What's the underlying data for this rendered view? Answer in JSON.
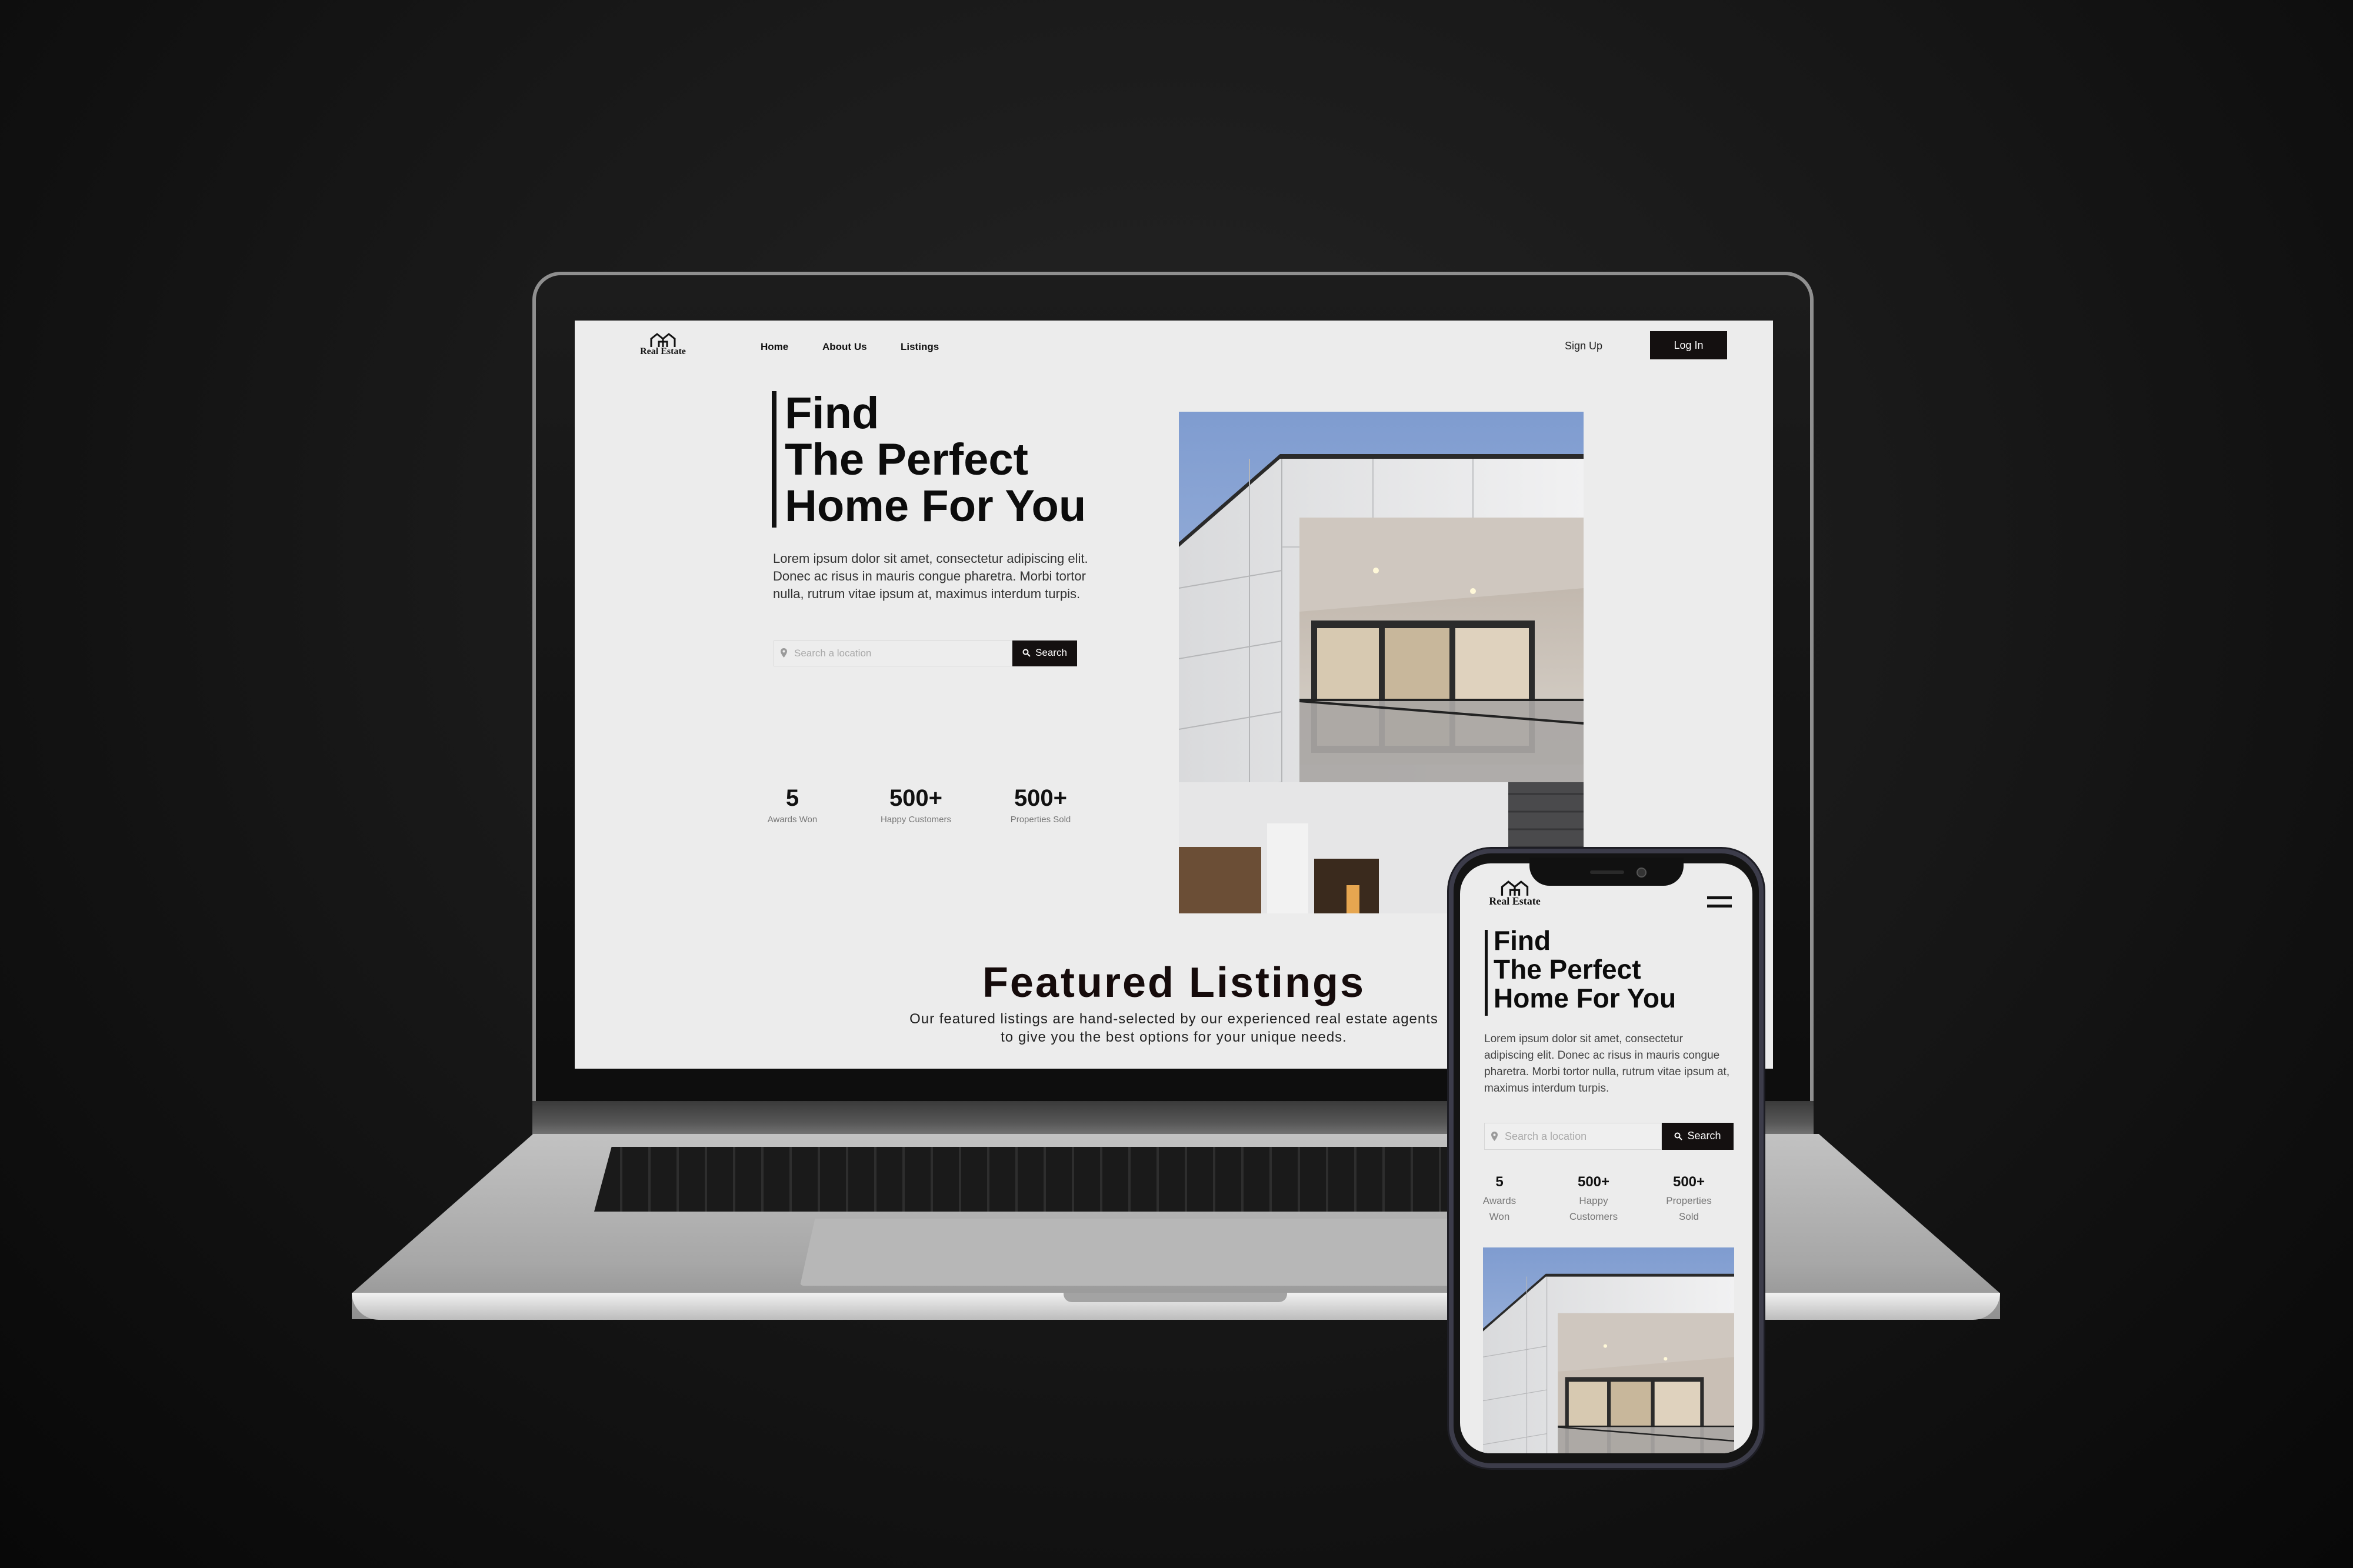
{
  "desktop": {
    "brand": "Real Estate",
    "nav": [
      "Home",
      "About Us",
      "Listings"
    ],
    "signup_label": "Sign Up",
    "login_label": "Log In",
    "hero": {
      "title": "Find\nThe Perfect\nHome For You",
      "description": "Lorem ipsum dolor sit amet, consectetur adipiscing elit. Donec ac risus in mauris congue pharetra. Morbi tortor nulla, rutrum vitae ipsum at, maximus interdum turpis.",
      "search_placeholder": "Search a location",
      "search_button": "Search"
    },
    "stats": [
      {
        "value": "5",
        "label": "Awards Won"
      },
      {
        "value": "500+",
        "label": "Happy Customers"
      },
      {
        "value": "500+",
        "label": "Properties Sold"
      }
    ],
    "featured": {
      "title": "Featured Listings",
      "subtitle_line1": "Our featured listings are hand-selected by our experienced real estate agents",
      "subtitle_line2": "to give you the best options for your unique needs."
    }
  },
  "mobile": {
    "brand": "Real Estate",
    "hero": {
      "title": "Find\nThe Perfect\nHome For You",
      "description": "Lorem ipsum dolor sit amet, consectetur adipiscing elit. Donec ac risus in mauris congue pharetra. Morbi tortor nulla, rutrum vitae ipsum at, maximus interdum turpis.",
      "search_placeholder": "Search a location",
      "search_button": "Search"
    },
    "stats": [
      {
        "value": "5",
        "label": "Awards Won"
      },
      {
        "value": "500+",
        "label": "Happy Customers"
      },
      {
        "value": "500+",
        "label": "Properties Sold"
      }
    ]
  },
  "icons": [
    "house-logo-icon",
    "location-pin-icon",
    "search-icon",
    "hamburger-menu-icon"
  ],
  "colors": {
    "accent_dark": "#141010",
    "page_bg": "#ececec",
    "text": "#0c0c0c"
  }
}
